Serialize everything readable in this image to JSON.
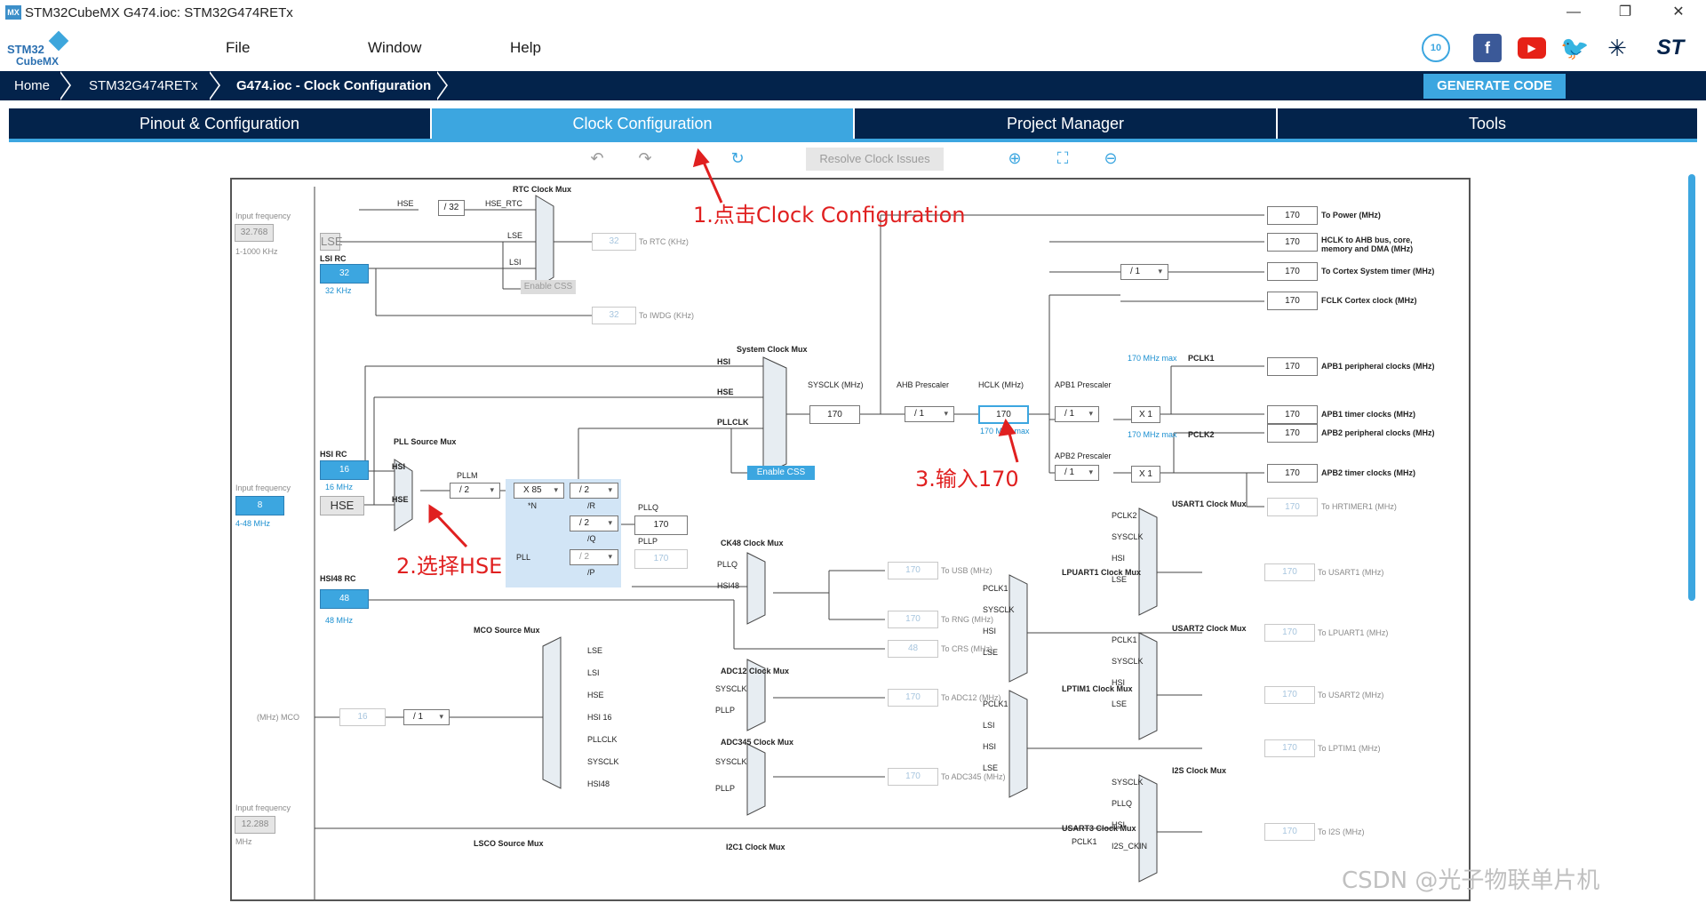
{
  "window": {
    "app_icon": "MX",
    "title": "STM32CubeMX G474.ioc: STM32G474RETx",
    "controls": [
      "—",
      "❐",
      "✕"
    ]
  },
  "menubar": {
    "logo_line1": "STM32",
    "logo_line2": "CubeMX",
    "items": [
      "File",
      "Window",
      "Help"
    ],
    "social_icons": [
      "anniversary-badge-icon",
      "facebook-icon",
      "youtube-icon",
      "twitter-icon",
      "network-icon",
      "st-logo-icon"
    ]
  },
  "breadcrumb": {
    "items": [
      "Home",
      "STM32G474RETx",
      "G474.ioc - Clock Configuration"
    ],
    "generate_label": "GENERATE CODE"
  },
  "tabs": {
    "items": [
      "Pinout & Configuration",
      "Clock Configuration",
      "Project Manager",
      "Tools"
    ],
    "active": "Clock Configuration"
  },
  "toolbar": {
    "resolve_label": "Resolve Clock Issues",
    "icons": [
      "undo-icon",
      "redo-icon",
      "refresh-icon",
      "zoom-in-icon",
      "fit-icon",
      "zoom-out-icon"
    ]
  },
  "clock": {
    "input_freq_label": "Input frequency",
    "lse_input": "32.768",
    "lse_range": "1-1000 KHz",
    "lse_label": "LSE",
    "lsi_rc_label": "LSI RC",
    "lsi_value": "32",
    "lsi_unit": "32 KHz",
    "rtc_mux_title": "RTC Clock Mux",
    "rtc_hse": "HSE",
    "rtc_div": "/ 32",
    "rtc_hse_rtc": "HSE_RTC",
    "rtc_lse": "LSE",
    "rtc_lsi": "LSI",
    "rtc_value": "32",
    "rtc_to": "To RTC (KHz)",
    "enable_css": "Enable CSS",
    "iwdg_value": "32",
    "iwdg_to": "To IWDG (KHz)",
    "hsi_rc_label": "HSI RC",
    "hsi_value": "16",
    "hsi_unit": "16 MHz",
    "hse_input": "8",
    "hse_range": "4-48 MHz",
    "hse_label": "HSE",
    "pll_src_title": "PLL Source Mux",
    "pll_hsi": "HSI",
    "pll_hse": "HSE",
    "pllm_label": "PLLM",
    "pllm_value": "/ 2",
    "pll_n_value": "X 85",
    "pll_n_label": "*N",
    "pll_r_value": "/ 2",
    "pll_r_label": "/R",
    "pll_q_value": "/ 2",
    "pll_q_label": "/Q",
    "pll_p_value": "/ 2",
    "pll_p_label": "/P",
    "pll_label": "PLL",
    "pllq_label": "PLLQ",
    "pllq_value": "170",
    "pllp_label": "PLLP",
    "pllp_value": "170",
    "sys_mux_title": "System Clock Mux",
    "sys_hsi": "HSI",
    "sys_hse": "HSE",
    "sys_pllclk": "PLLCLK",
    "enable_css2": "Enable CSS",
    "sysclk_label": "SYSCLK (MHz)",
    "sysclk_value": "170",
    "ahb_label": "AHB Prescaler",
    "ahb_value": "/ 1",
    "hclk_label": "HCLK (MHz)",
    "hclk_value": "170",
    "hclk_max": "170 MHz max",
    "apb1_label": "APB1 Prescaler",
    "apb1_value": "/ 1",
    "apb1_max": "170 MHz max",
    "pclk1": "PCLK1",
    "apb1_x": "X 1",
    "apb2_label": "APB2 Prescaler",
    "apb2_value": "/ 1",
    "apb2_max": "170 MHz max",
    "pclk2": "PCLK2",
    "apb2_x": "X 1",
    "cortex_div": "/ 1",
    "outputs": [
      {
        "value": "170",
        "label": "To Power (MHz)"
      },
      {
        "value": "170",
        "label": "HCLK to AHB bus, core, memory and DMA (MHz)"
      },
      {
        "value": "170",
        "label": "To Cortex System timer (MHz)"
      },
      {
        "value": "170",
        "label": "FCLK Cortex clock (MHz)"
      },
      {
        "value": "170",
        "label": "APB1 peripheral clocks (MHz)"
      },
      {
        "value": "170",
        "label": "APB1 timer clocks (MHz)"
      },
      {
        "value": "170",
        "label": "APB2 peripheral clocks (MHz)"
      },
      {
        "value": "170",
        "label": "APB2 timer clocks (MHz)"
      },
      {
        "value": "170",
        "label": "To HRTIMER1 (MHz)"
      }
    ],
    "hsi48_label": "HSI48 RC",
    "hsi48_value": "48",
    "hsi48_unit": "48 MHz",
    "ck48_title": "CK48 Clock Mux",
    "ck48_pllq": "PLLQ",
    "ck48_hsi48": "HSI48",
    "usb_value": "170",
    "usb_to": "To USB (MHz)",
    "rng_value": "170",
    "rng_to": "To RNG (MHz)",
    "crs_value": "48",
    "crs_to": "To CRS (MHz)",
    "mco_title": "MCO Source Mux",
    "mco_items": [
      "LSE",
      "LSI",
      "HSE",
      "HSI 16",
      "PLLCLK",
      "SYSCLK",
      "HSI48"
    ],
    "mco_label": "(MHz) MCO",
    "mco_value": "16",
    "mco_div": "/ 1",
    "adc12_title": "ADC12 Clock Mux",
    "adc12_sysclk": "SYSCLK",
    "adc12_pllp": "PLLP",
    "adc12_value": "170",
    "adc12_to": "To ADC12 (MHz)",
    "adc345_title": "ADC345 Clock Mux",
    "adc345_sysclk": "SYSCLK",
    "adc345_pllp": "PLLP",
    "adc345_value": "170",
    "adc345_to": "To ADC345 (MHz)",
    "usart1_title": "USART1 Clock Mux",
    "usart1_items": [
      "PCLK2",
      "SYSCLK",
      "HSI",
      "LSE"
    ],
    "usart1_value": "170",
    "usart1_to": "To USART1 (MHz)",
    "lpuart1_title": "LPUART1 Clock Mux",
    "lpuart1_items": [
      "PCLK1",
      "SYSCLK",
      "HSI",
      "LSE"
    ],
    "lpuart1_value": "170",
    "lpuart1_to": "To LPUART1 (MHz)",
    "usart2_title": "USART2 Clock Mux",
    "usart2_items": [
      "PCLK1",
      "SYSCLK",
      "HSI",
      "LSE"
    ],
    "usart2_value": "170",
    "usart2_to": "To USART2 (MHz)",
    "lptim1_title": "LPTIM1 Clock Mux",
    "lptim1_items": [
      "PCLK1",
      "LSI",
      "HSI",
      "LSE"
    ],
    "lptim1_value": "170",
    "lptim1_to": "To LPTIM1 (MHz)",
    "i2s_title": "I2S Clock Mux",
    "i2s_items": [
      "SYSCLK",
      "PLLQ",
      "HSI",
      "I2S_CKIN"
    ],
    "i2s_value": "170",
    "i2s_to": "To I2S (MHz)",
    "usart3_title": "USART3 Clock Mux",
    "usart3_first": "PCLK1",
    "lsco_title": "LSCO Source Mux",
    "i2c1_title": "I2C1 Clock Mux",
    "bottom_input_label": "Input frequency",
    "bottom_input_value": "12.288",
    "bottom_input_unit": "MHz"
  },
  "annotations": {
    "step1": "1.点击Clock Configuration",
    "step2": "2.选择HSE",
    "step3": "3.输入170"
  },
  "watermark": "CSDN @光子物联单片机"
}
